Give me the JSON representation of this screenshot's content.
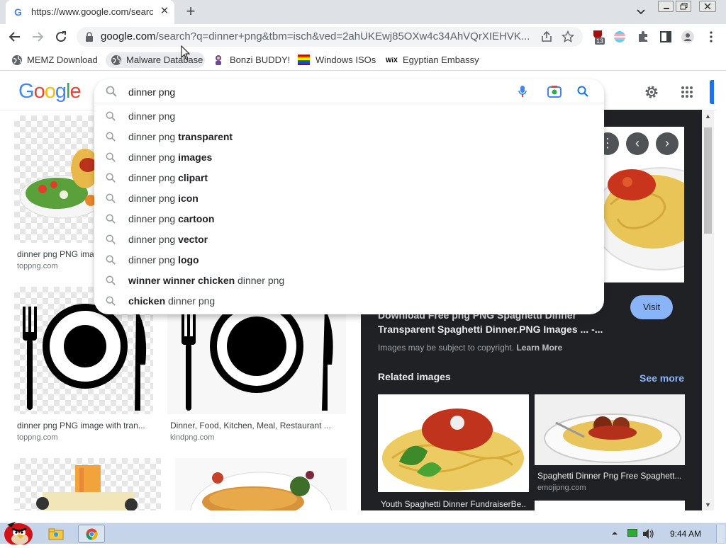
{
  "browser": {
    "tab_title": "https://www.google.com/search",
    "tab_favicon": "G",
    "address_host": "google.com",
    "address_rest": "/search?q=dinner+png&tbm=isch&ved=2ahUKEwj85OXw4c34AhVQrXIEHVK...",
    "extension_badge": "13",
    "bookmarks": [
      {
        "label": "MEMZ Download",
        "icon": "globe-icon"
      },
      {
        "label": "Malware Database",
        "icon": "globe-icon"
      },
      {
        "label": "Bonzi BUDDY!",
        "icon": "bonzi-icon"
      },
      {
        "label": "Windows ISOs",
        "icon": "rainbow-flag-icon"
      },
      {
        "label": "Egyptian Embassy",
        "icon": "wix-icon"
      }
    ]
  },
  "google": {
    "logo": "Google",
    "search_value": "dinner png",
    "suggestions": [
      {
        "pre": "dinner png",
        "bold": "",
        "post": ""
      },
      {
        "pre": "dinner png ",
        "bold": "transparent",
        "post": ""
      },
      {
        "pre": "dinner png ",
        "bold": "images",
        "post": ""
      },
      {
        "pre": "dinner png ",
        "bold": "clipart",
        "post": ""
      },
      {
        "pre": "dinner png ",
        "bold": "icon",
        "post": ""
      },
      {
        "pre": "dinner png ",
        "bold": "cartoon",
        "post": ""
      },
      {
        "pre": "dinner png ",
        "bold": "vector",
        "post": ""
      },
      {
        "pre": "dinner png ",
        "bold": "logo",
        "post": ""
      },
      {
        "pre": "",
        "bold": "winner winner chicken",
        "post": " dinner png"
      },
      {
        "pre": "",
        "bold": "chicken",
        "post": " dinner png"
      }
    ]
  },
  "results": [
    {
      "title": "dinner png PNG image with transparent background",
      "source": "toppng.com"
    },
    {
      "title": "dinner png PNG image with tran...",
      "source": "toppng.com"
    },
    {
      "title": "Dinner, Food, Kitchen, Meal, Restaurant ...",
      "source": "kindpng.com"
    }
  ],
  "panel": {
    "title_line1": "Download Free png PNG Spaghetti Dinner",
    "title_line2": "Transparent Spaghetti Dinner.PNG Images ... -...",
    "visit": "Visit",
    "copyright": "Images may be subject to copyright.",
    "learn_more": "Learn More",
    "related_heading": "Related images",
    "see_more": "See more",
    "related": [
      {
        "caption": "Youth Spaghetti Dinner FundraiserBe...",
        "source": ""
      },
      {
        "caption": "Spaghetti Dinner Png Free Spaghett...",
        "source": "emojipng.com"
      }
    ]
  },
  "taskbar": {
    "clock": "9:44 AM"
  },
  "colors": {
    "google_blue": "#4285f4",
    "google_red": "#ea4335",
    "google_yellow": "#fbbc05",
    "google_green": "#34a853",
    "panel_bg": "#202124",
    "link_blue": "#8ab4f8"
  }
}
